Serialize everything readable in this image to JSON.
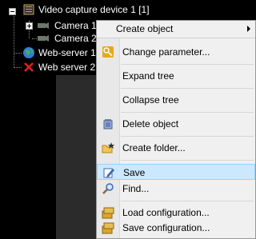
{
  "tree": {
    "items": [
      {
        "label": "Video capture device 1 [1]"
      },
      {
        "label": "Camera 1"
      },
      {
        "label": "Camera 2"
      },
      {
        "label": "Web-server 1"
      },
      {
        "label": "Web server 2.0"
      }
    ]
  },
  "menu": {
    "create_object": "Create object",
    "items": [
      {
        "label": "Change parameter...",
        "icon": "key-icon"
      },
      {
        "label": "Expand tree",
        "icon": ""
      },
      {
        "label": "Collapse tree",
        "icon": ""
      },
      {
        "label": "Delete object",
        "icon": "recycle-bin-icon"
      },
      {
        "label": "Create folder...",
        "icon": "new-folder-icon"
      },
      {
        "label": "Save",
        "icon": "save-edit-icon"
      },
      {
        "label": "Find...",
        "icon": "magnifier-icon"
      },
      {
        "label": "Load configuration...",
        "icon": "load-config-icon"
      },
      {
        "label": "Save configuration...",
        "icon": "save-config-icon"
      }
    ],
    "highlighted_index": 5
  },
  "colors": {
    "menu_bg": "#f0f0f0",
    "highlight_bg": "#cce8ff",
    "highlight_border": "#99d1ff"
  }
}
